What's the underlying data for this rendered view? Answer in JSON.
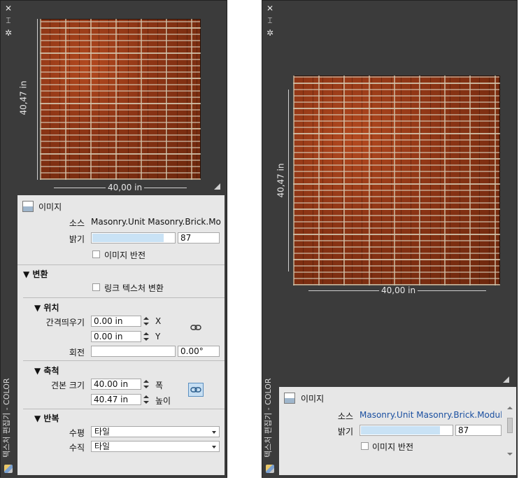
{
  "left_panel": {
    "vertical_title": "텍스처 편집기 - COLOR",
    "dim_height": "40,47 in",
    "dim_width": "40,00 in",
    "image_section": {
      "title": "이미지",
      "source_label": "소스",
      "source_value": "Masonry.Unit Masonry.Brick.Modular.Pinwheel.Red.jpg",
      "brightness_label": "밝기",
      "brightness_value": "87",
      "brightness_fraction": 0.87,
      "invert_label": "이미지 반전"
    },
    "transform": {
      "title": "변환",
      "link_label": "링크 텍스처 변환"
    },
    "position": {
      "title": "위치",
      "offset_label": "간격띄우기",
      "x_value": "0.00 in",
      "x_axis": "X",
      "y_value": "0.00 in",
      "y_axis": "Y",
      "rotation_label": "회전",
      "rotation_value": "0.00°"
    },
    "scale": {
      "title": "축척",
      "sample_size_label": "견본 크기",
      "width_value": "40.00 in",
      "width_label": "폭",
      "height_value": "40.47 in",
      "height_label": "높이"
    },
    "repeat": {
      "title": "반복",
      "horizontal_label": "수평",
      "horizontal_value": "타일",
      "vertical_label": "수직",
      "vertical_value": "타일"
    }
  },
  "right_panel": {
    "vertical_title": "텍스처 편집기 - COLOR",
    "dim_height": "40,47 in",
    "dim_width": "40,00 in",
    "image_section": {
      "title": "이미지",
      "source_label": "소스",
      "source_value": "Masonry.Unit Masonry.Brick.Modular.Pinwheel.Red.jpg",
      "brightness_label": "밝기",
      "brightness_value": "87",
      "brightness_fraction": 0.87,
      "invert_label": "이미지 반전"
    }
  },
  "titlebar_icons": [
    "close-icon",
    "pin-icon",
    "settings-icon"
  ],
  "colors": {
    "panel_bg": "#3b3b3b",
    "props_bg": "#e7e7e7",
    "bar_fill": "#c9e2f5",
    "link_active": "#c7dff3",
    "source_link": "#1a4fa0"
  }
}
